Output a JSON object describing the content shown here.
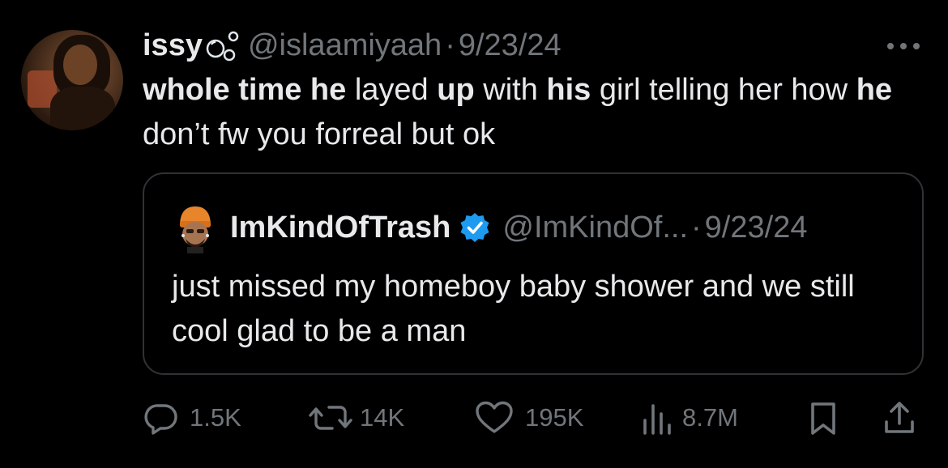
{
  "tweet": {
    "author": {
      "display_name": "issy",
      "name_emoji_icon": "bubbles-icon",
      "handle": "@islaamiyaah",
      "separator": "·",
      "date": "9/23/24"
    },
    "text_segments": [
      {
        "text": "whole time he",
        "bold": true
      },
      {
        "text": " layed ",
        "bold": false
      },
      {
        "text": "up",
        "bold": true
      },
      {
        "text": " with ",
        "bold": false
      },
      {
        "text": "his",
        "bold": true
      },
      {
        "text": " girl telling her how ",
        "bold": false
      },
      {
        "text": "he",
        "bold": true
      },
      {
        "text": " don’t fw you forreal but ok",
        "bold": false
      }
    ],
    "quoted": {
      "display_name": "ImKindOfTrash",
      "verified": true,
      "handle": "@ImKindOf...",
      "separator": "·",
      "date": "9/23/24",
      "text": "just missed my homeboy baby shower and we still cool glad to be a man"
    },
    "actions": {
      "replies": "1.5K",
      "reposts": "14K",
      "likes": "195K",
      "views": "8.7M"
    }
  },
  "colors": {
    "background": "#000000",
    "primary_text": "#e7e9ea",
    "secondary_text": "#71767b",
    "border": "#2f3336",
    "verified_blue": "#1d9bf0"
  },
  "icons": {
    "more": "more-icon",
    "reply": "reply-icon",
    "repost": "repost-icon",
    "like": "heart-icon",
    "views": "views-icon",
    "bookmark": "bookmark-icon",
    "share": "share-icon",
    "verified": "verified-icon"
  }
}
